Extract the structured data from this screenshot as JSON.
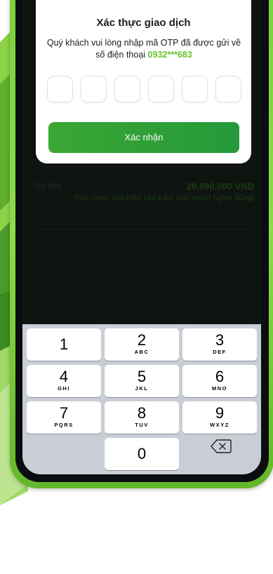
{
  "otp_dialog": {
    "title": "Xác thực giao dịch",
    "description": "Quý khách vui lòng nhập mã OTP đã được gửi về số điện thoại",
    "phone_number": "0932***683",
    "otp_length": 6,
    "confirm_label": "Xác nhận"
  },
  "background_content": {
    "amount_label": "Số tiền",
    "amount_value": "28,690,000 VND",
    "amount_words": "(Hai mươi tám triệu sáu trăm chín mươi nghìn đồng)"
  },
  "keypad": {
    "keys": [
      {
        "digit": "1",
        "letters": ""
      },
      {
        "digit": "2",
        "letters": "ABC"
      },
      {
        "digit": "3",
        "letters": "DEF"
      },
      {
        "digit": "4",
        "letters": "GHI"
      },
      {
        "digit": "5",
        "letters": "JKL"
      },
      {
        "digit": "6",
        "letters": "MNO"
      },
      {
        "digit": "7",
        "letters": "PQRS"
      },
      {
        "digit": "8",
        "letters": "TUV"
      },
      {
        "digit": "9",
        "letters": "WXYZ"
      },
      {
        "digit": "0",
        "letters": ""
      }
    ],
    "backspace_icon": "backspace-icon"
  },
  "colors": {
    "brand_green": "#6ac12a",
    "button_green": "#2e9f37",
    "phone_frame": "#7ad03a"
  }
}
